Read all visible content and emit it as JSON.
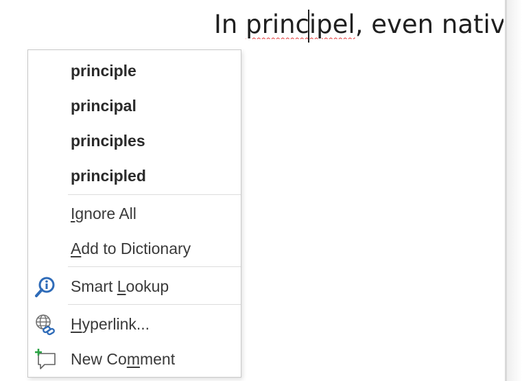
{
  "document": {
    "text_before_word": "In ",
    "misspelled_word": "principel",
    "text_after_word": ", even native"
  },
  "context_menu": {
    "suggestions": [
      "principle",
      "principal",
      "principles",
      "principled"
    ],
    "ignore_all": {
      "pre": "",
      "key": "I",
      "post": "gnore All"
    },
    "add_to_dictionary": {
      "pre": "",
      "key": "A",
      "post": "dd to Dictionary"
    },
    "smart_lookup": {
      "pre": "Smart ",
      "key": "L",
      "post": "ookup",
      "icon": "smart-lookup-icon"
    },
    "hyperlink": {
      "pre": "",
      "key": "H",
      "post": "yperlink...",
      "icon": "hyperlink-globe-icon"
    },
    "new_comment": {
      "pre": "New Co",
      "key": "m",
      "post": "ment",
      "icon": "new-comment-icon"
    }
  },
  "colors": {
    "squiggle": "#e23636",
    "icon_blue": "#2e6bb8",
    "menu_border": "#c8c8c8"
  }
}
